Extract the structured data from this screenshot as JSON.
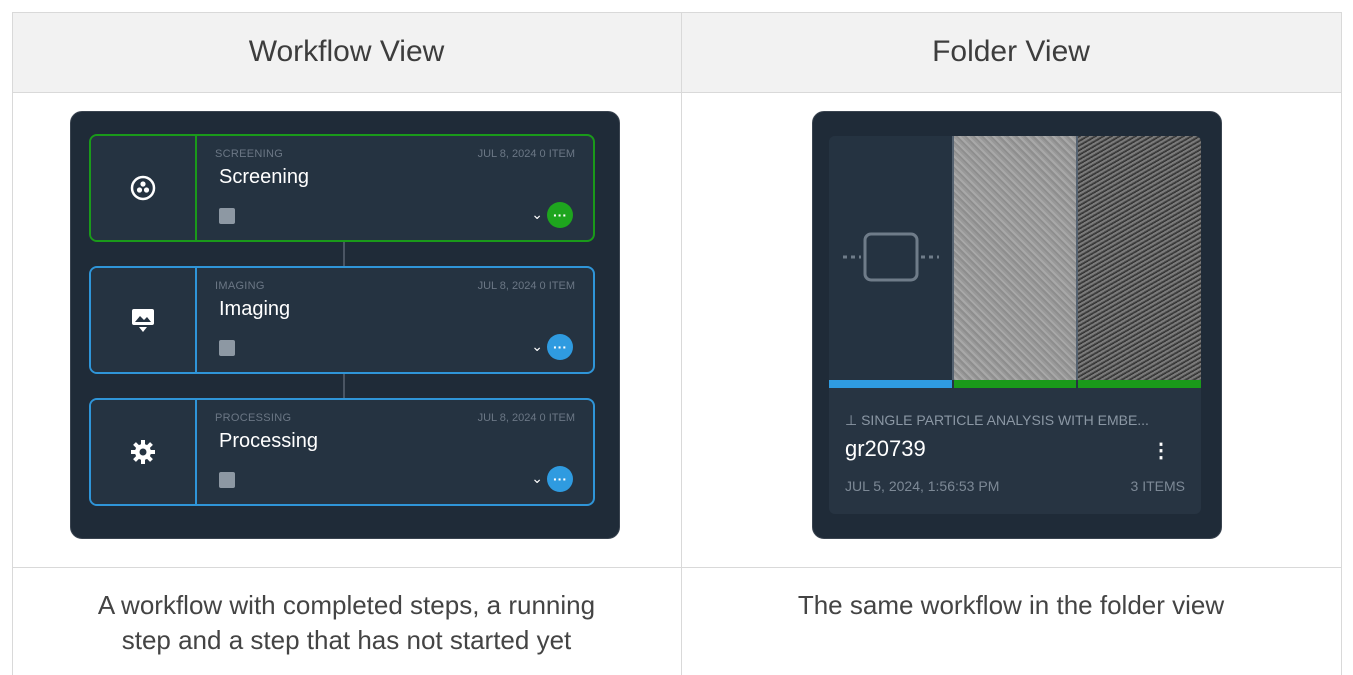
{
  "headers": {
    "left": "Workflow View",
    "right": "Folder View"
  },
  "captions": {
    "left_line1": "A workflow with completed steps, a running",
    "left_line2": "step and a step that has not started yet",
    "right": "The same workflow in the folder view"
  },
  "workflow": {
    "steps": [
      {
        "tag": "SCREENING",
        "date": "JUL 8, 2024   0 ITEM",
        "title": "Screening",
        "status": "green",
        "icon": "screening-icon"
      },
      {
        "tag": "IMAGING",
        "date": "JUL 8, 2024   0 ITEM",
        "title": "Imaging",
        "status": "blue",
        "icon": "imaging-icon"
      },
      {
        "tag": "PROCESSING",
        "date": "JUL 8, 2024   0 ITEM",
        "title": "Processing",
        "status": "blue",
        "icon": "gear-icon"
      }
    ]
  },
  "folder": {
    "subtitle": "SINGLE PARTICLE ANALYSIS WITH EMBE...",
    "name": "gr20739",
    "timestamp": "JUL 5, 2024, 1:56:53 PM",
    "count": "3 ITEMS"
  },
  "colors": {
    "green": "#1a9a1a",
    "blue": "#2f95d8",
    "panel": "#1f2b38"
  }
}
